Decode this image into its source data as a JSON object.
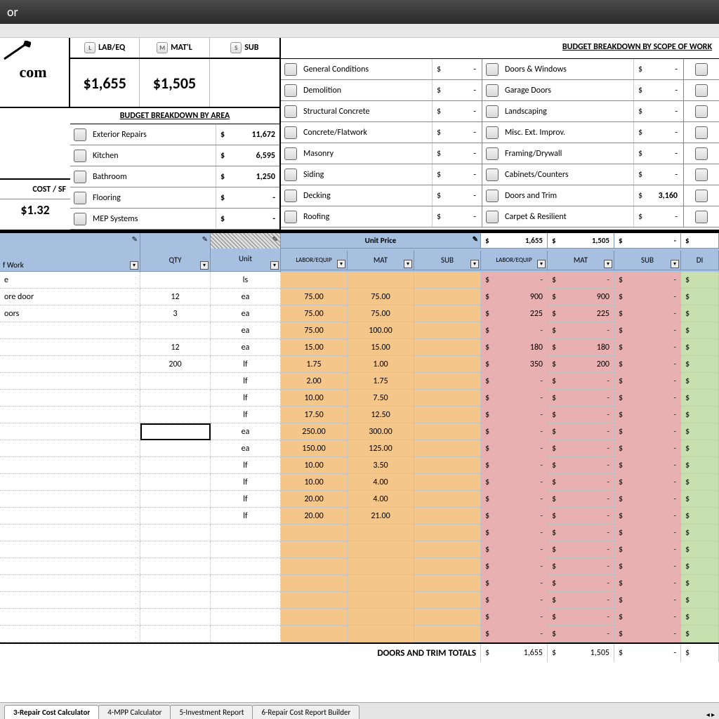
{
  "window": {
    "title_suffix": "or"
  },
  "topLabels": {
    "lab": "LAB/EQ",
    "mat": "MAT'L",
    "sub": "SUB"
  },
  "topTotals": {
    "lab": "$1,655",
    "mat": "$1,505",
    "sub": ""
  },
  "costSF": {
    "label": "COST / SF",
    "value": "$1.32"
  },
  "areaHeader": "BUDGET BREAKDOWN BY AREA",
  "areaRows": [
    {
      "label": "Exterior Repairs",
      "value": "11,672"
    },
    {
      "label": "Kitchen",
      "value": "6,595"
    },
    {
      "label": "Bathroom",
      "value": "1,250"
    },
    {
      "label": "Flooring",
      "value": "-"
    },
    {
      "label": "MEP Systems",
      "value": "-"
    }
  ],
  "scopeHeader": "BUDGET BREAKDOWN BY SCOPE OF WORK",
  "scopeCol1": [
    {
      "label": "General Conditions",
      "value": "-"
    },
    {
      "label": "Demolition",
      "value": "-"
    },
    {
      "label": "Structural Concrete",
      "value": "-"
    },
    {
      "label": "Concrete/Flatwork",
      "value": "-"
    },
    {
      "label": "Masonry",
      "value": "-"
    },
    {
      "label": "Siding",
      "value": "-"
    },
    {
      "label": "Decking",
      "value": "-"
    },
    {
      "label": "Roofing",
      "value": "-"
    }
  ],
  "scopeCol2": [
    {
      "label": "Doors & Windows",
      "value": "-"
    },
    {
      "label": "Garage Doors",
      "value": "-"
    },
    {
      "label": "Landscaping",
      "value": "-"
    },
    {
      "label": "Misc. Ext. Improv.",
      "value": "-"
    },
    {
      "label": "Framing/Drywall",
      "value": "-"
    },
    {
      "label": "Cabinets/Counters",
      "value": "-"
    },
    {
      "label": "Doors and Trim",
      "value": "3,160"
    },
    {
      "label": "Carpet & Resilient",
      "value": "-"
    }
  ],
  "columns": {
    "scope": "f Work",
    "qty": "QTY",
    "unit": "Unit",
    "unitPrice": "Unit Price",
    "le": "LABOR/EQUIP",
    "mat": "MAT",
    "sub": "SUB",
    "diy": "DI"
  },
  "headerTotals": {
    "lab": "1,655",
    "mat": "1,505",
    "sub": "-"
  },
  "rows": [
    {
      "scope": "e",
      "qty": "",
      "unit": "ls",
      "pl": "",
      "pm": "",
      "lab": "-",
      "mat": "-",
      "sub": "-"
    },
    {
      "scope": "ore door",
      "qty": "12",
      "unit": "ea",
      "pl": "75.00",
      "pm": "75.00",
      "lab": "900",
      "mat": "900",
      "sub": "-"
    },
    {
      "scope": "oors",
      "qty": "3",
      "unit": "ea",
      "pl": "75.00",
      "pm": "75.00",
      "lab": "225",
      "mat": "225",
      "sub": "-"
    },
    {
      "scope": "",
      "qty": "",
      "unit": "ea",
      "pl": "75.00",
      "pm": "100.00",
      "lab": "-",
      "mat": "-",
      "sub": "-"
    },
    {
      "scope": "",
      "qty": "12",
      "unit": "ea",
      "pl": "15.00",
      "pm": "15.00",
      "lab": "180",
      "mat": "180",
      "sub": "-"
    },
    {
      "scope": "",
      "qty": "200",
      "unit": "lf",
      "pl": "1.75",
      "pm": "1.00",
      "lab": "350",
      "mat": "200",
      "sub": "-"
    },
    {
      "scope": "",
      "qty": "",
      "unit": "lf",
      "pl": "2.00",
      "pm": "1.75",
      "lab": "-",
      "mat": "-",
      "sub": "-"
    },
    {
      "scope": "",
      "qty": "",
      "unit": "lf",
      "pl": "10.00",
      "pm": "7.50",
      "lab": "-",
      "mat": "-",
      "sub": "-"
    },
    {
      "scope": "",
      "qty": "",
      "unit": "lf",
      "pl": "17.50",
      "pm": "12.50",
      "lab": "-",
      "mat": "-",
      "sub": "-"
    },
    {
      "scope": "",
      "qty": "",
      "unit": "ea",
      "pl": "250.00",
      "pm": "300.00",
      "lab": "-",
      "mat": "-",
      "sub": "-",
      "sel": true
    },
    {
      "scope": "",
      "qty": "",
      "unit": "ea",
      "pl": "150.00",
      "pm": "125.00",
      "lab": "-",
      "mat": "-",
      "sub": "-"
    },
    {
      "scope": "",
      "qty": "",
      "unit": "lf",
      "pl": "10.00",
      "pm": "3.50",
      "lab": "-",
      "mat": "-",
      "sub": "-"
    },
    {
      "scope": "",
      "qty": "",
      "unit": "lf",
      "pl": "10.00",
      "pm": "4.00",
      "lab": "-",
      "mat": "-",
      "sub": "-"
    },
    {
      "scope": "",
      "qty": "",
      "unit": "lf",
      "pl": "20.00",
      "pm": "4.00",
      "lab": "-",
      "mat": "-",
      "sub": "-"
    },
    {
      "scope": "",
      "qty": "",
      "unit": "lf",
      "pl": "20.00",
      "pm": "21.00",
      "lab": "-",
      "mat": "-",
      "sub": "-"
    },
    {
      "scope": "",
      "qty": "",
      "unit": "",
      "pl": "",
      "pm": "",
      "lab": "-",
      "mat": "-",
      "sub": "-"
    },
    {
      "scope": "",
      "qty": "",
      "unit": "",
      "pl": "",
      "pm": "",
      "lab": "-",
      "mat": "-",
      "sub": "-"
    },
    {
      "scope": "",
      "qty": "",
      "unit": "",
      "pl": "",
      "pm": "",
      "lab": "-",
      "mat": "-",
      "sub": "-"
    },
    {
      "scope": "",
      "qty": "",
      "unit": "",
      "pl": "",
      "pm": "",
      "lab": "-",
      "mat": "-",
      "sub": "-"
    },
    {
      "scope": "",
      "qty": "",
      "unit": "",
      "pl": "",
      "pm": "",
      "lab": "-",
      "mat": "-",
      "sub": "-"
    },
    {
      "scope": "",
      "qty": "",
      "unit": "",
      "pl": "",
      "pm": "",
      "lab": "-",
      "mat": "-",
      "sub": "-"
    },
    {
      "scope": "",
      "qty": "",
      "unit": "",
      "pl": "",
      "pm": "",
      "lab": "-",
      "mat": "-",
      "sub": "-"
    }
  ],
  "footer": {
    "label": "DOORS AND TRIM TOTALS",
    "lab": "1,655",
    "mat": "1,505",
    "sub": "-"
  },
  "tabs": [
    "3-Repair Cost Calculator",
    "4-MPP Calculator",
    "5-Investment Report",
    "6-Repair Cost Report Builder"
  ],
  "logoText": "com"
}
